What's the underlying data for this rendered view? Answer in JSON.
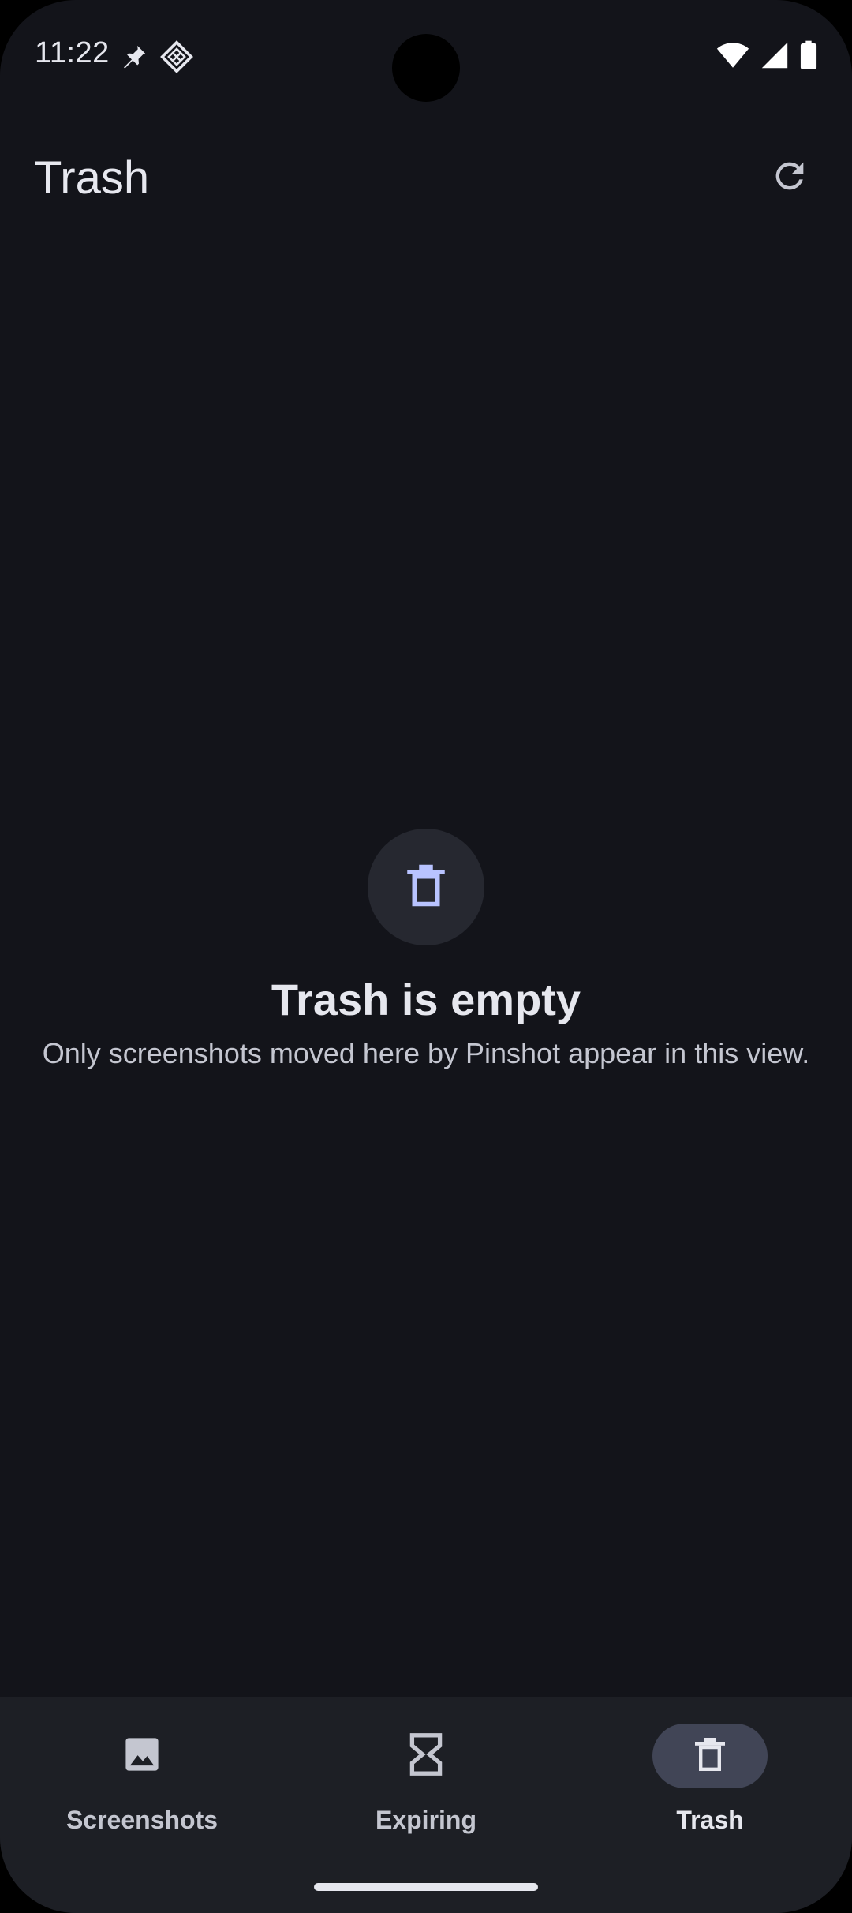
{
  "status_bar": {
    "time": "11:22",
    "icons": [
      "pin-icon",
      "grid-diamond-icon",
      "wifi-icon",
      "cellular-signal-icon",
      "battery-icon"
    ]
  },
  "app_bar": {
    "title": "Trash",
    "action_icon": "refresh-icon"
  },
  "empty_state": {
    "icon": "trash-icon",
    "title": "Trash is empty",
    "message": "Only screenshots moved here by Pinshot appear in this view."
  },
  "bottom_nav": {
    "items": [
      {
        "label": "Screenshots",
        "icon": "image-icon",
        "selected": false
      },
      {
        "label": "Expiring",
        "icon": "hourglass-icon",
        "selected": false
      },
      {
        "label": "Trash",
        "icon": "trash-icon",
        "selected": true
      }
    ]
  },
  "colors": {
    "background": "#13141a",
    "nav_background": "#1d1f25",
    "active_indicator": "#414556",
    "accent_icon": "#b8c3ff",
    "text_primary": "#e6e7ee",
    "text_secondary": "#c4c6d0"
  }
}
